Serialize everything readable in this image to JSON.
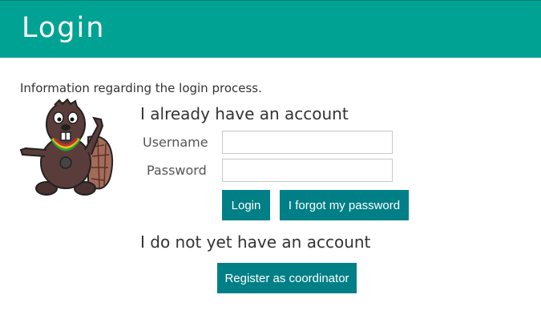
{
  "header": {
    "title": "Login"
  },
  "intro": "Information regarding the login process.",
  "login_section": {
    "title": "I already have an account",
    "username_label": "Username",
    "password_label": "Password",
    "username_value": "",
    "password_value": "",
    "login_button": "Login",
    "forgot_button": "I forgot my password"
  },
  "register_section": {
    "title": "I do not yet have an account",
    "register_button": "Register as coordinator"
  },
  "colors": {
    "header": "#00a293",
    "button": "#007f86"
  }
}
